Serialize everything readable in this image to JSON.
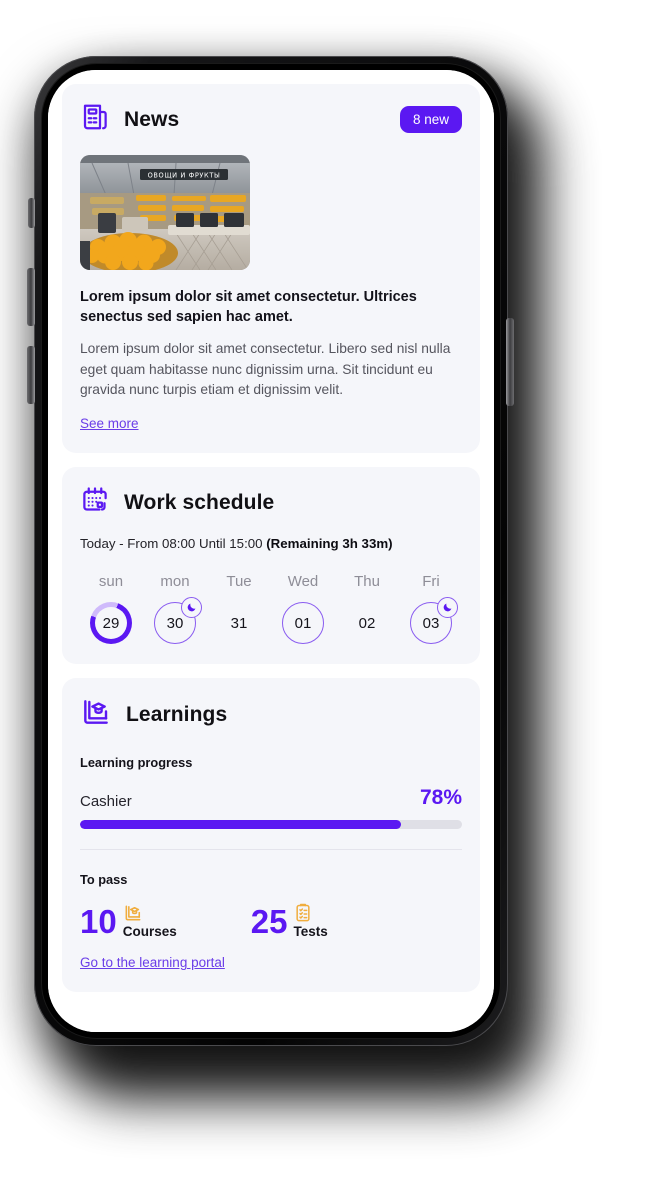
{
  "theme": {
    "accent": "#5b18f2",
    "accent_light": "#8a5cf0",
    "accent_pale": "#cfbafb",
    "link": "#6a3de8",
    "card_bg": "#f5f6fa",
    "page_bg": "#ffffff",
    "icon_amber": "#f0ad3e",
    "text_primary": "#14131a",
    "text_muted": "#8e8d97"
  },
  "news": {
    "icon": "newspaper-icon",
    "title": "News",
    "badge": "8 new",
    "thumb_alt": "grocery-store-produce-aisle",
    "thumb_sign_text": "ОВОЩИ И ФРУКТЫ",
    "headline": "Lorem ipsum dolor sit amet consectetur. Ultrices senectus sed sapien hac amet.",
    "body": "Lorem ipsum dolor sit amet consectetur. Libero sed nisl nulla eget quam habitasse nunc dignissim urna. Sit tincidunt eu gravida nunc turpis etiam et dignissim velit.",
    "see_more": "See more"
  },
  "work_schedule": {
    "icon": "calendar-icon",
    "title": "Work schedule",
    "today_prefix": "Today - From 08:00 Until 15:00 ",
    "remaining": "(Remaining 3h 33m)",
    "days": [
      {
        "label": "sun",
        "date": "29",
        "state": "today",
        "night": false
      },
      {
        "label": "mon",
        "date": "30",
        "state": "outline",
        "night": true
      },
      {
        "label": "Tue",
        "date": "31",
        "state": "plain",
        "night": false
      },
      {
        "label": "Wed",
        "date": "01",
        "state": "outline",
        "night": false
      },
      {
        "label": "Thu",
        "date": "02",
        "state": "plain",
        "night": false
      },
      {
        "label": "Fri",
        "date": "03",
        "state": "outline",
        "night": true
      }
    ]
  },
  "learnings": {
    "icon": "book-graduation-icon",
    "title": "Learnings",
    "progress_label": "Learning progress",
    "course_name": "Cashier",
    "course_percent": "78%",
    "course_percent_value": 78,
    "to_pass_label": "To pass",
    "stats": [
      {
        "value": "10",
        "label": "Courses",
        "icon": "book-graduation-icon"
      },
      {
        "value": "25",
        "label": "Tests",
        "icon": "clipboard-checklist-icon"
      }
    ],
    "portal_link": "Go to the learning portal"
  }
}
